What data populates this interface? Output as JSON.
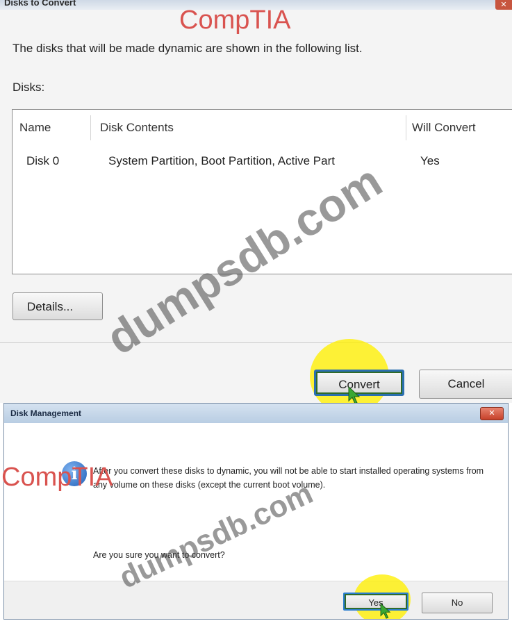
{
  "top_dialog": {
    "title": "Disks to Convert",
    "close_symbol": "✕",
    "description": "The disks that will be made dynamic are shown in the following list.",
    "disks_label": "Disks:",
    "columns": [
      "Name",
      "Disk Contents",
      "Will Convert"
    ],
    "rows": [
      {
        "name": "Disk 0",
        "contents": "System Partition, Boot Partition, Active Part",
        "will_convert": "Yes"
      }
    ],
    "details_button": "Details...",
    "convert_button": "Convert",
    "cancel_button": "Cancel"
  },
  "message_dialog": {
    "title": "Disk Management",
    "close_symbol": "✕",
    "info_icon_glyph": "i",
    "message": "After you convert these disks to dynamic, you will not be able to start installed operating systems from any volume on these disks (except the current boot volume).",
    "confirm": "Are you sure you want to convert?",
    "yes_button": "Yes",
    "no_button": "No"
  },
  "watermarks": {
    "comptia": "CompTIA",
    "dumps": "dumpsdb.com"
  },
  "colors": {
    "highlight": "#fff000",
    "focus_border": "#2b6fb0",
    "watermark_red": "#d9534f"
  }
}
